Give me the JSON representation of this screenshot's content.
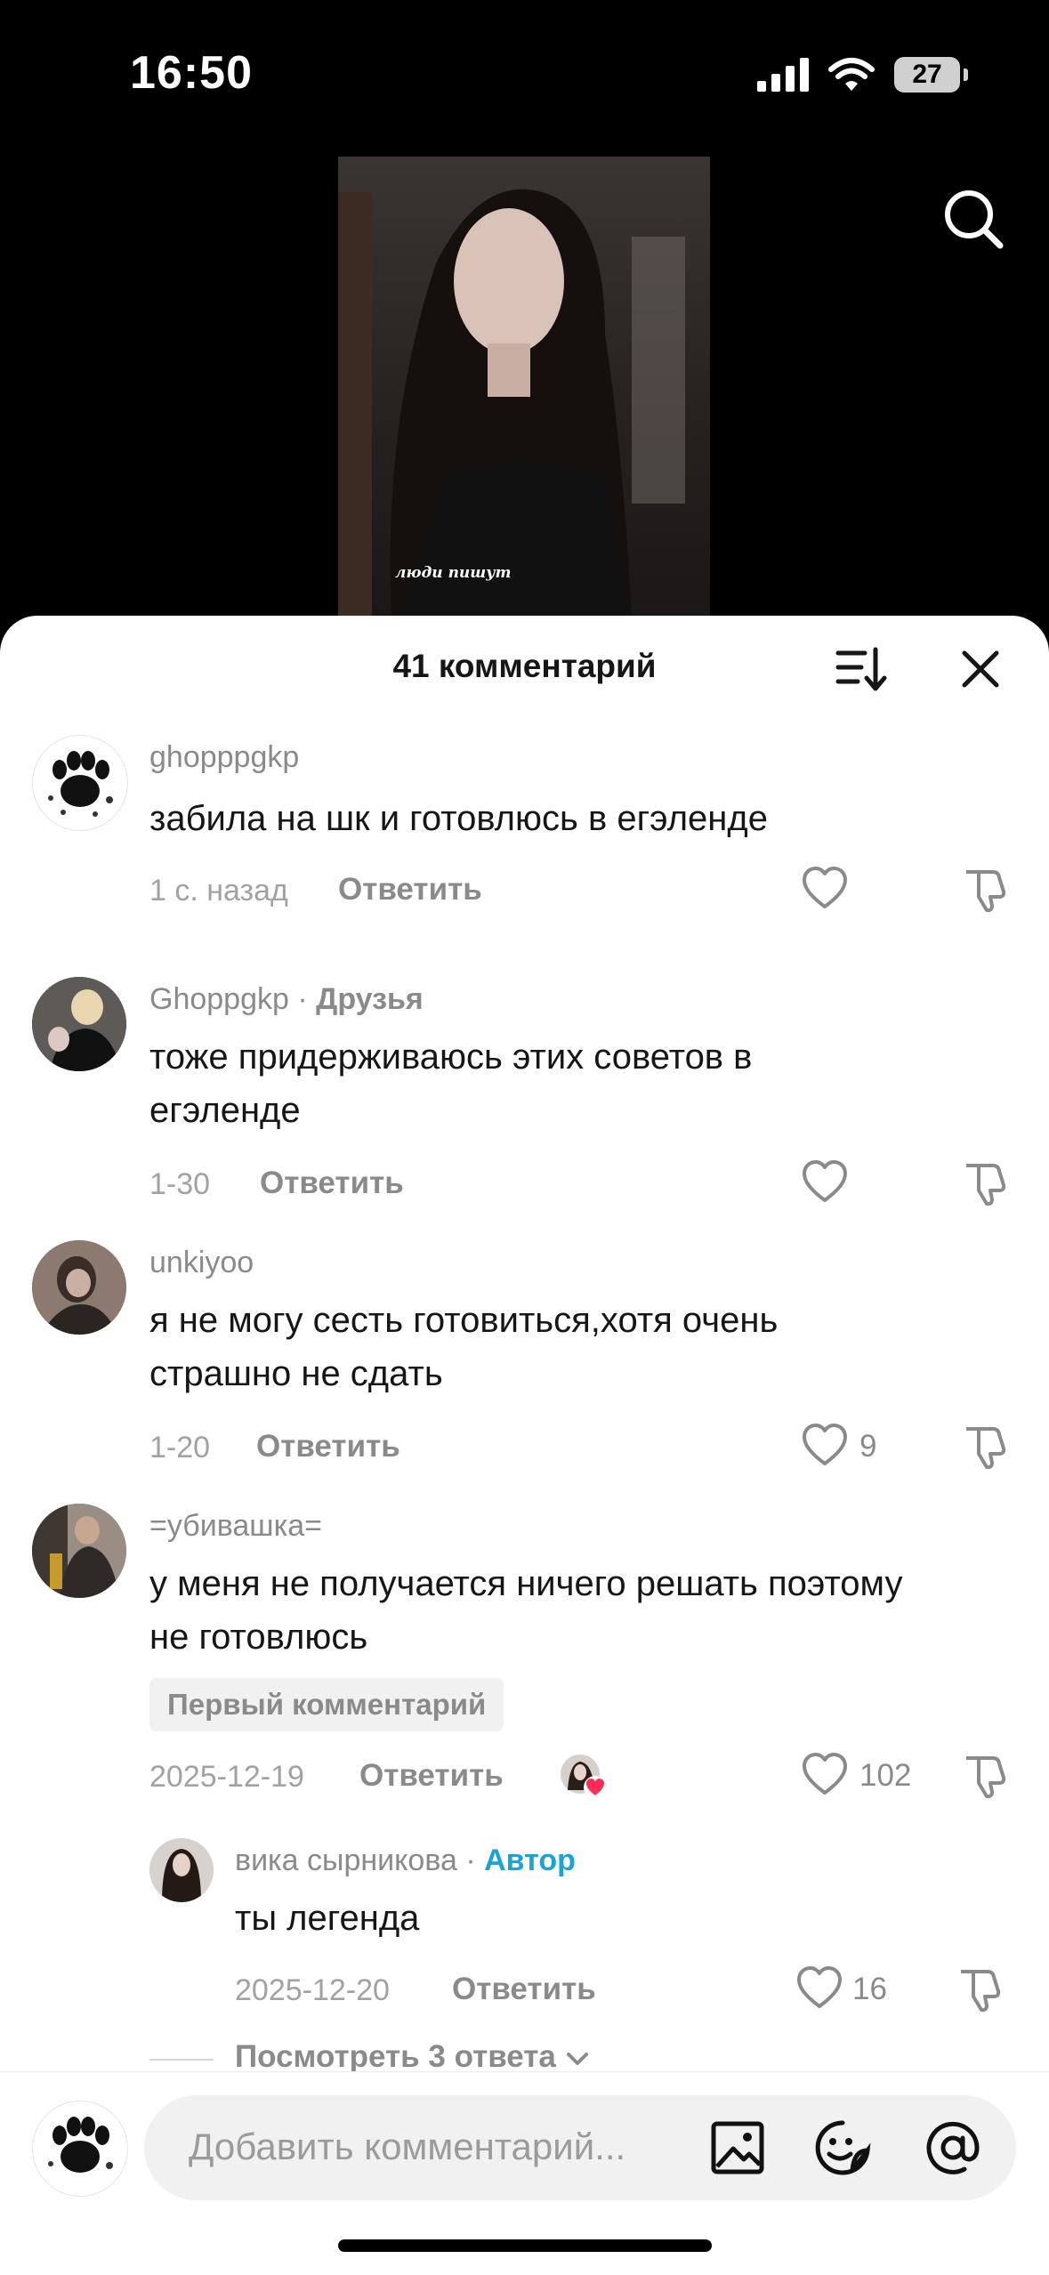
{
  "status_bar": {
    "time": "16:50",
    "battery": "27"
  },
  "video": {
    "caption": "люди пишут"
  },
  "sheet": {
    "title": "41 комментарий"
  },
  "comments": [
    {
      "username": "ghopppgkp",
      "text": "забила на шк и готовлюсь в егэленде",
      "time": "1 с. назад",
      "reply_label": "Ответить",
      "likes": ""
    },
    {
      "username": "Ghoppgkp",
      "tag": "Друзья",
      "text": "тоже придерживаюсь этих советов в егэленде",
      "time": "1-30",
      "reply_label": "Ответить",
      "likes": ""
    },
    {
      "username": "unkiyoo",
      "text": "я не могу сесть готовиться,хотя очень страшно не сдать",
      "time": "1-20",
      "reply_label": "Ответить",
      "likes": "9"
    },
    {
      "username": "=убивашка=",
      "text": "у меня не получается ничего решать поэтому не готовлюсь",
      "badge": "Первый комментарий",
      "time": "2025-12-19",
      "reply_label": "Ответить",
      "likes": "102"
    }
  ],
  "reply": {
    "username": "вика сырникова",
    "tag": "Автор",
    "text": "ты легенда",
    "time": "2025-12-20",
    "reply_label": "Ответить",
    "likes": "16"
  },
  "view_replies": "Посмотреть 3 ответа",
  "input": {
    "placeholder": "Добавить комментарий..."
  },
  "colors": {
    "author_tag": "#1aa3d6",
    "heart": "#ff2c55"
  }
}
